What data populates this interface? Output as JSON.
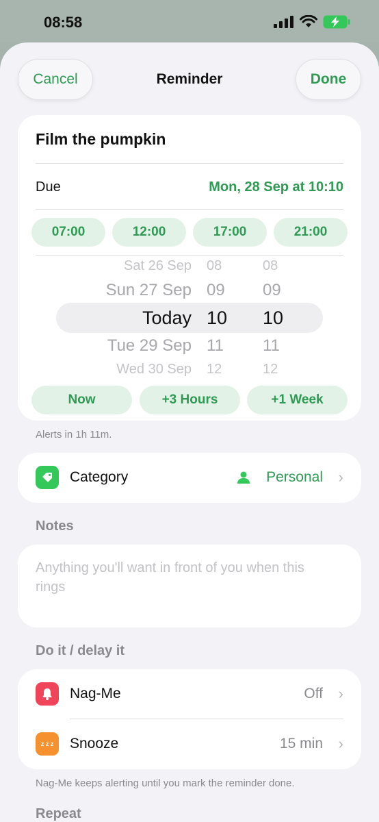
{
  "status": {
    "time": "08:58"
  },
  "nav": {
    "cancel": "Cancel",
    "title": "Reminder",
    "done": "Done"
  },
  "reminder": {
    "title": "Film the pumpkin",
    "due_label": "Due",
    "due_value": "Mon, 28 Sep at 10:10",
    "quick_times": [
      "07:00",
      "12:00",
      "17:00",
      "21:00"
    ],
    "picker": [
      {
        "date": "Sat 26 Sep",
        "hour": "08",
        "min": "08"
      },
      {
        "date": "Sun 27 Sep",
        "hour": "09",
        "min": "09"
      },
      {
        "date": "Today",
        "hour": "10",
        "min": "10"
      },
      {
        "date": "Tue 29 Sep",
        "hour": "11",
        "min": "11"
      },
      {
        "date": "Wed 30 Sep",
        "hour": "12",
        "min": "12"
      }
    ],
    "offsets": [
      "Now",
      "+3 Hours",
      "+1 Week"
    ]
  },
  "alerts_hint": "Alerts in 1h 11m.",
  "category": {
    "label": "Category",
    "value": "Personal",
    "icon": "tag-icon",
    "value_icon": "person-icon"
  },
  "notes": {
    "header": "Notes",
    "placeholder": "Anything you'll want in front of you when this rings"
  },
  "delay": {
    "header": "Do it / delay it",
    "nag": {
      "label": "Nag-Me",
      "value": "Off",
      "icon": "bell-icon"
    },
    "snooze": {
      "label": "Snooze",
      "value": "15 min",
      "icon": "zz-icon",
      "icon_text": "z z z"
    },
    "footer": "Nag-Me keeps alerting until you mark the reminder done."
  },
  "repeat": {
    "header": "Repeat"
  },
  "colors": {
    "accent": "#2e9a53",
    "chip_bg": "#e3f2e7",
    "nag_icon": "#f0445a",
    "snooze_icon": "#f5922f",
    "category_icon": "#34c759"
  }
}
